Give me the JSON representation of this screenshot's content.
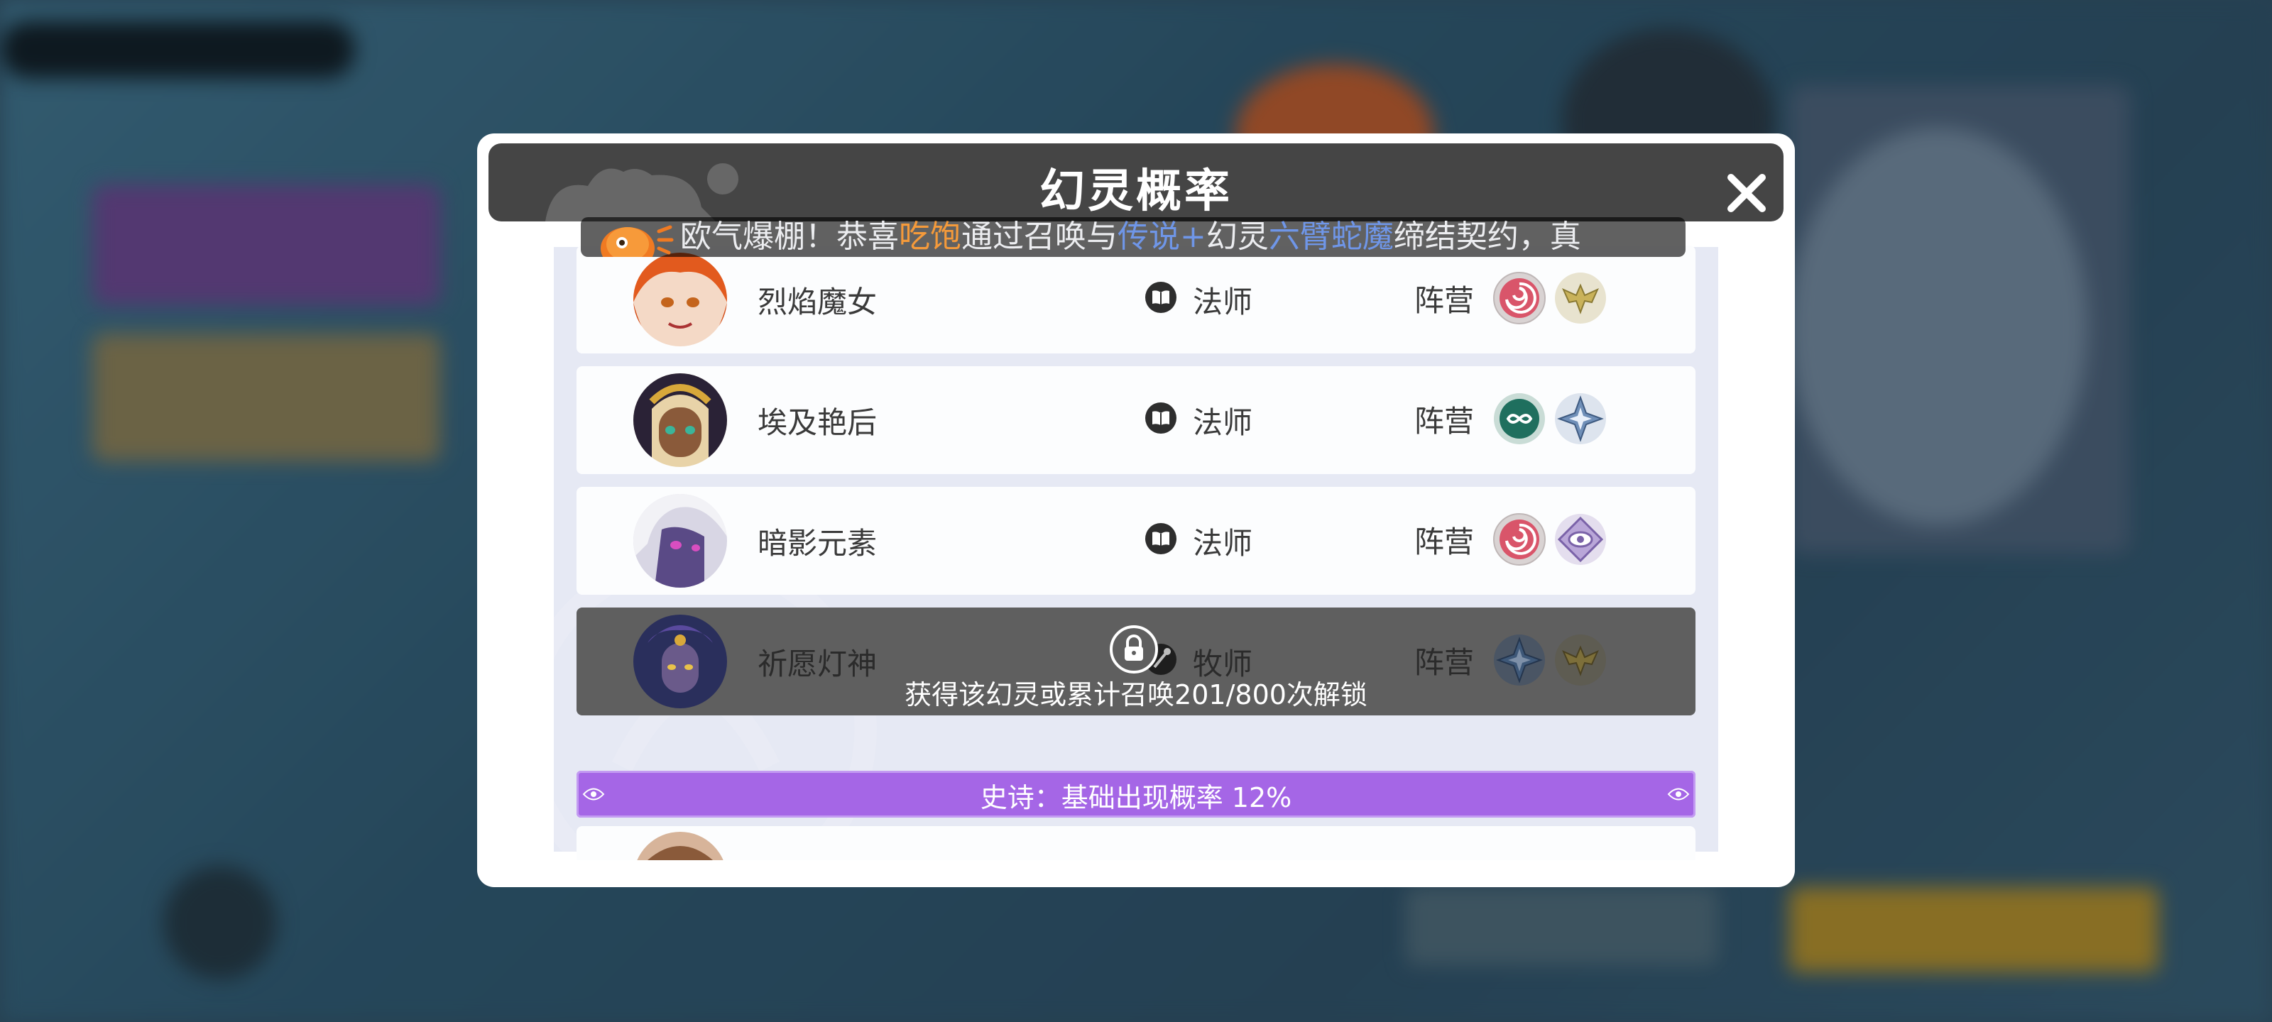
{
  "dialog": {
    "title": "幻灵概率"
  },
  "marquee": {
    "parts": [
      "欧气爆棚！恭喜",
      "吃饱",
      "通过召唤与",
      "传说+",
      "幻灵",
      "六臂蛇魔",
      "缔结契约，真"
    ]
  },
  "rows": [
    {
      "name": "烈焰魔女",
      "role": "法师",
      "faction_label": "阵营",
      "faction_icons": [
        "swirl-red-icon",
        "wings-gold-icon"
      ]
    },
    {
      "name": "埃及艳后",
      "role": "法师",
      "faction_label": "阵营",
      "faction_icons": [
        "infinity-green-icon",
        "star-blue-icon"
      ]
    },
    {
      "name": "暗影元素",
      "role": "法师",
      "faction_label": "阵营",
      "faction_icons": [
        "swirl-red-icon",
        "eye-purple-icon"
      ]
    },
    {
      "name": "祈愿灯神",
      "role": "牧师",
      "faction_label": "阵营",
      "faction_icons": [
        "star-blue-icon",
        "wings-gold-icon"
      ],
      "locked": true,
      "unlock_text": "获得该幻灵或累计召唤201/800次解锁"
    }
  ],
  "tier": {
    "label": "史诗：基础出现概率  12%",
    "color": "#a566e6"
  },
  "colors": {
    "header_bg": "#454545",
    "accent_orange": "#f59a3a",
    "accent_blue": "#6f96e8"
  }
}
